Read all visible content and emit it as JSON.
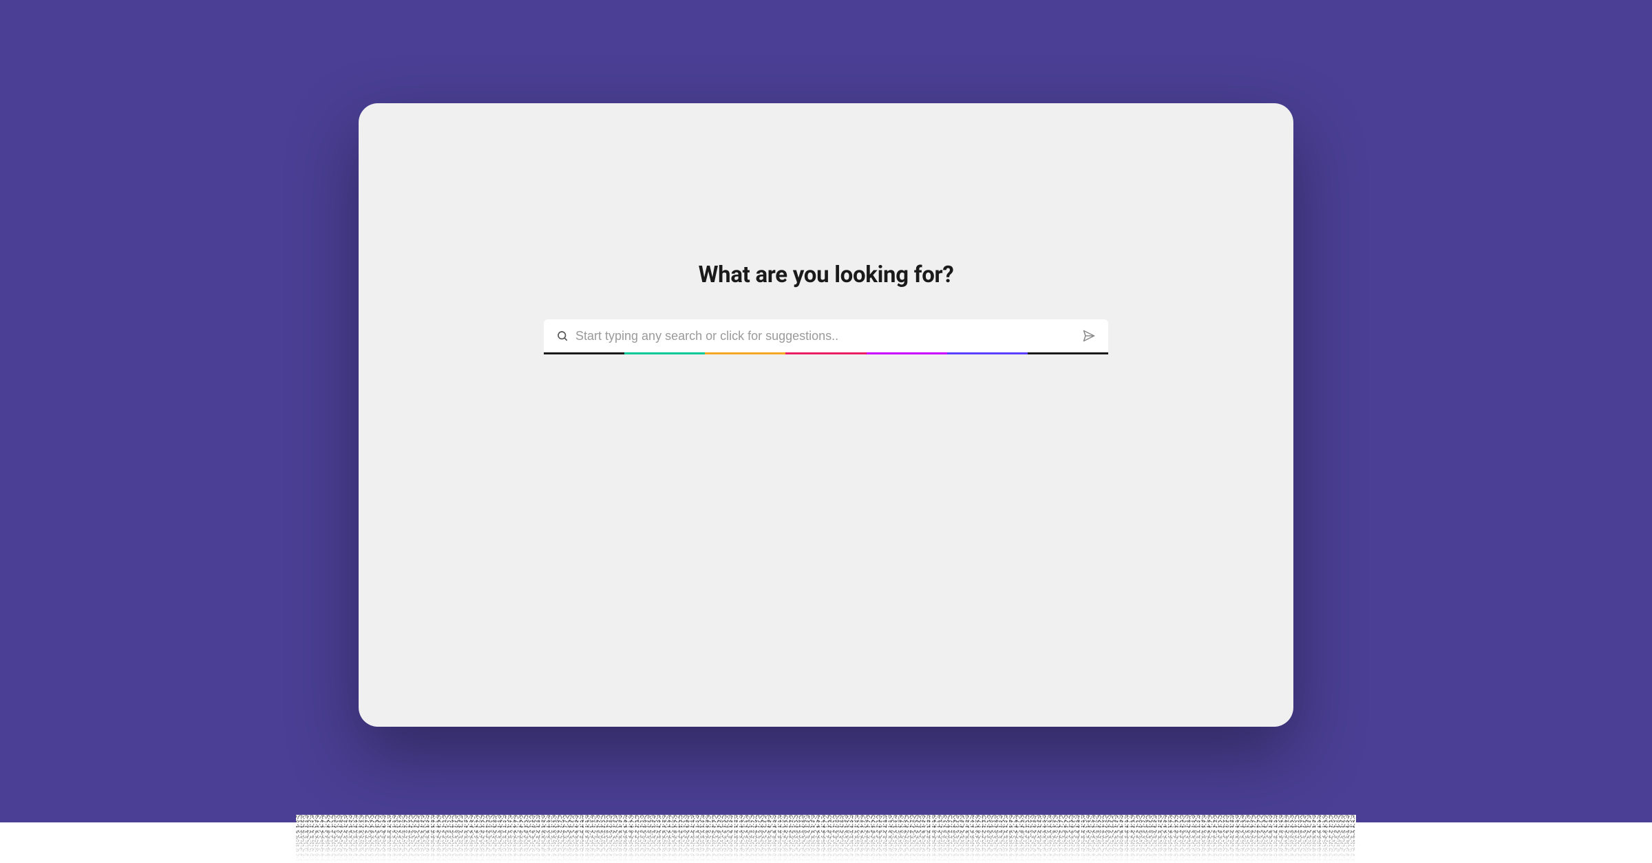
{
  "heading": "What are you looking for?",
  "search": {
    "placeholder": "Start typing any search or click for suggestions..",
    "value": ""
  },
  "colors": {
    "backdrop": "#4a3f94",
    "card": "#f0f0f0",
    "rainbow": [
      "#1a1a1a",
      "#00c896",
      "#f5a623",
      "#e91e63",
      "#c800ff",
      "#5b3fff",
      "#1a1a1a"
    ]
  }
}
